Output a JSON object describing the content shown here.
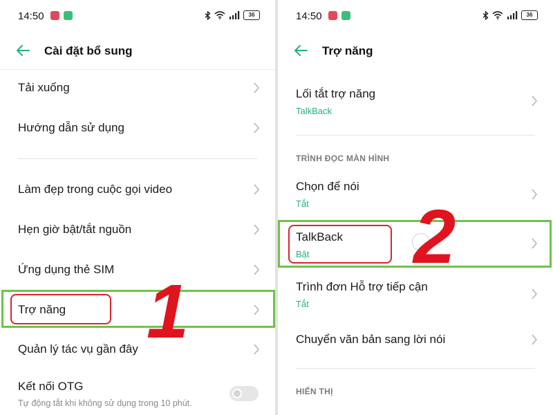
{
  "left_panel": {
    "status": {
      "time": "14:50",
      "battery": "36"
    },
    "header": {
      "title": "Cài đặt bổ sung"
    },
    "items": [
      {
        "label": "Tải xuống"
      },
      {
        "label": "Hướng dẫn sử dụng"
      },
      {
        "label": "Làm đẹp trong cuộc gọi video"
      },
      {
        "label": "Hẹn giờ bật/tắt nguồn"
      },
      {
        "label": "Ứng dụng thẻ SIM"
      },
      {
        "label": "Trợ năng"
      },
      {
        "label": "Quản lý tác vụ gần đây"
      },
      {
        "label": "Kết nối OTG",
        "subtitle": "Tự động tắt khi không sử dụng trong 10 phút."
      }
    ],
    "step_number": "1"
  },
  "right_panel": {
    "status": {
      "time": "14:50",
      "battery": "36"
    },
    "header": {
      "title": "Trợ năng"
    },
    "shortcut": {
      "label": "Lối tắt trợ năng",
      "subtitle": "TalkBack"
    },
    "section_screen_reader": "TRÌNH ĐỌC MÀN HÌNH",
    "select_to_speak": {
      "label": "Chọn để nói",
      "subtitle": "Tắt"
    },
    "talkback": {
      "label": "TalkBack",
      "subtitle": "Bật"
    },
    "accessibility_menu": {
      "label": "Trình đơn Hỗ trợ tiếp cận",
      "subtitle": "Tắt"
    },
    "text_to_speech": {
      "label": "Chuyển văn bản sang lời nói"
    },
    "section_display": "HIỂN THỊ",
    "step_number": "2"
  },
  "colors": {
    "accent_green": "#24b079",
    "highlight_green": "#6fc24a",
    "highlight_red": "#d9232e",
    "number_red": "#e0141f"
  },
  "icons": [
    "back-arrow-icon",
    "chevron-right-icon",
    "bluetooth-icon",
    "wifi-icon",
    "signal-icon",
    "battery-icon"
  ]
}
